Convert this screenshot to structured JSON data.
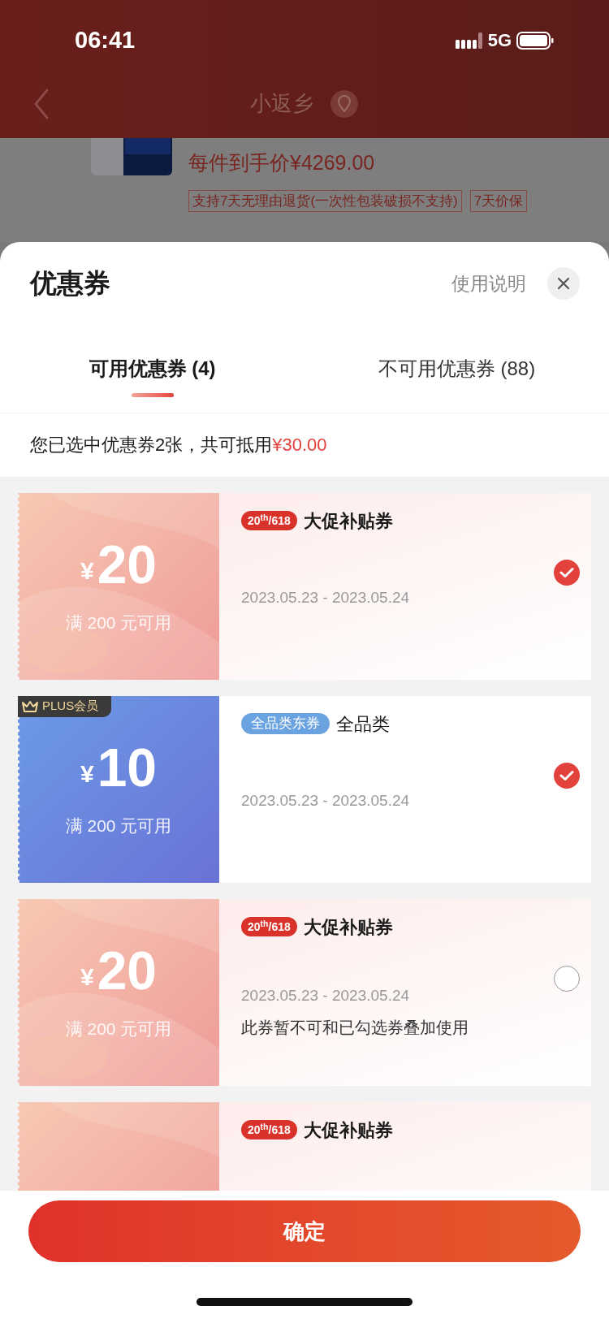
{
  "status_bar": {
    "time": "06:41",
    "network": "5G"
  },
  "background_page": {
    "nav_title": "小返乡",
    "price": "每件到手价¥4269.00",
    "tags": [
      "支持7天无理由退货(一次性包装破损不支持)",
      "7天价保"
    ]
  },
  "sheet": {
    "title": "优惠券",
    "help_link": "使用说明",
    "tabs": [
      {
        "label": "可用优惠券 (4)",
        "selected": true
      },
      {
        "label": "不可用优惠券 (88)",
        "selected": false
      }
    ],
    "summary": {
      "text": "您已选中优惠券2张，共可抵用",
      "amount": "¥30.00"
    },
    "coupons": [
      {
        "kind": "promo",
        "currency": "¥",
        "amount": "20",
        "condition": "满 200 元可用",
        "badge": "20$^{th}$/618",
        "title": "大促补贴券",
        "dates": "2023.05.23 - 2023.05.24",
        "selected": true
      },
      {
        "kind": "plus",
        "member_tag": "PLUS会员",
        "currency": "¥",
        "amount": "10",
        "condition": "满 200 元可用",
        "badge": "全品类东券",
        "title": "全品类",
        "dates": "2023.05.23 - 2023.05.24",
        "selected": true
      },
      {
        "kind": "promo",
        "currency": "¥",
        "amount": "20",
        "condition": "满 200 元可用",
        "badge": "20$^{th}$/618",
        "title": "大促补贴券",
        "dates": "2023.05.23 - 2023.05.24",
        "note": "此券暂不可和已勾选券叠加使用",
        "selected": false
      },
      {
        "kind": "promo",
        "badge": "20$^{th}$/618",
        "title": "大促补贴券"
      }
    ],
    "confirm_button": "确定"
  }
}
